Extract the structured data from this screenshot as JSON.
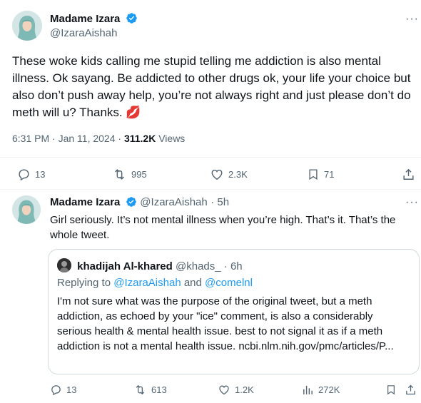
{
  "main_tweet": {
    "author_name": "Madame Izara",
    "author_handle": "@IzaraAishah",
    "text": "These woke kids calling me stupid telling me addiction is also mental illness. Ok sayang. Be addicted to other drugs ok, your life your choice but also don’t push away help, you’re not always right and just please don’t do meth will u? Thanks. 💋",
    "time": "6:31 PM · Jan 11, 2024 · ",
    "views_count": "311.2K",
    "views_label": " Views",
    "stats": {
      "replies": "13",
      "retweets": "995",
      "likes": "2.3K",
      "bookmarks": "71"
    }
  },
  "reply_tweet": {
    "author_name": "Madame Izara",
    "author_handle": "@IzaraAishah",
    "time": "· 5h",
    "text": "Girl seriously. It’s not mental illness when you’re high. That’s it. That’s the whole tweet.",
    "quote": {
      "author_name": "khadijah Al-khared",
      "author_handle": "@khads_",
      "time": "· 6h",
      "replying_prefix": "Replying to ",
      "replying_user1": "@IzaraAishah",
      "replying_and": " and ",
      "replying_user2": "@comelnl",
      "text": "I'm not sure what was the purpose of the original tweet, but a meth addiction, as echoed by your \"ice\" comment, is also a considerably serious health & mental health issue. best to not signal it as if a meth addiction is not a mental health issue. ncbi.nlm.nih.gov/pmc/articles/P..."
    },
    "stats": {
      "replies": "13",
      "retweets": "613",
      "likes": "1.2K",
      "views": "272K"
    }
  },
  "more_glyph": "···",
  "colors": {
    "accent": "#1d9bf0",
    "secondary_text": "#536471",
    "text": "#0f1419",
    "border": "#cfd9de"
  }
}
